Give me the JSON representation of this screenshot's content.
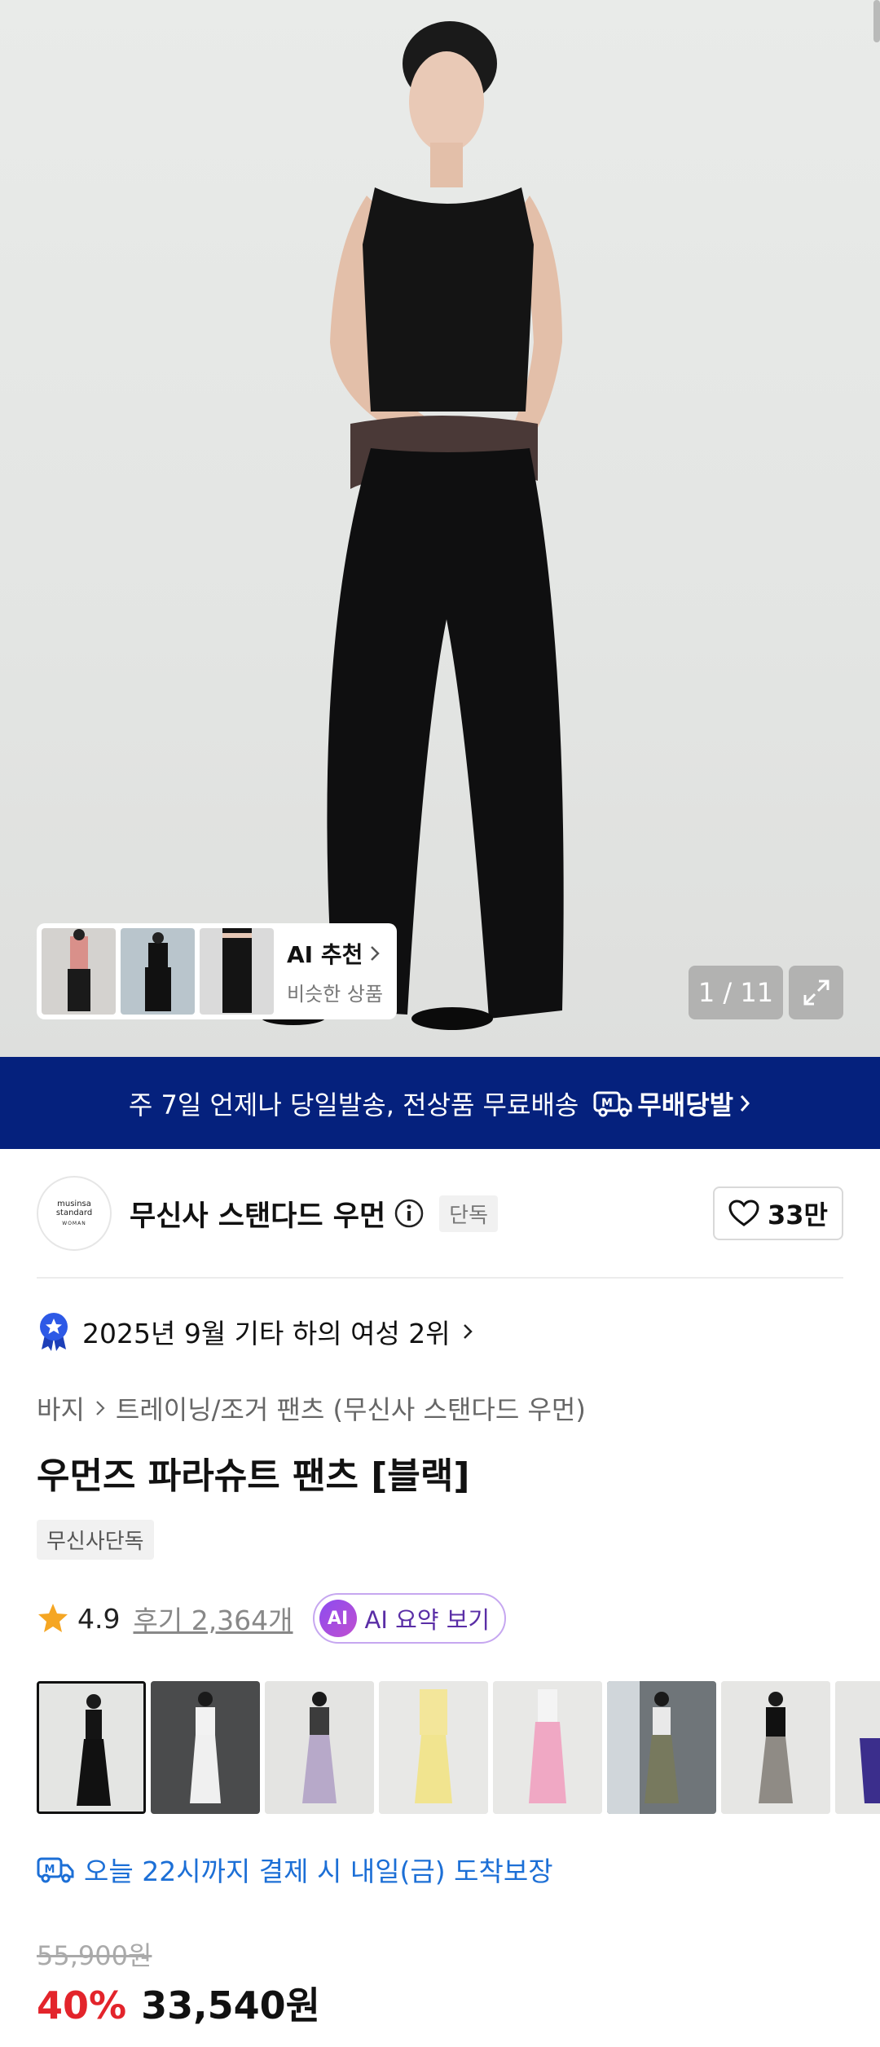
{
  "hero": {
    "counter": "1 / 11",
    "ai_card": {
      "title": "AI 추천",
      "subtitle": "비슷한 상품"
    }
  },
  "banner": {
    "text": "주 7일 언제나 당일발송, 전상품 무료배송",
    "brand": "무배당발"
  },
  "brand": {
    "logo_line1": "musinsa",
    "logo_line2": "standard",
    "logo_line3": "WOMAN",
    "name": "무신사 스탠다드 우먼",
    "badge": "단독",
    "likes": "33만"
  },
  "rank": {
    "text": "2025년 9월 기타 하의 여성 2위"
  },
  "breadcrumb": {
    "level1": "바지",
    "level2": "트레이닝/조거 팬츠 (무신사 스탠다드 우먼)"
  },
  "product": {
    "title": "우먼즈 파라슈트 팬츠 [블랙]",
    "tag": "무신사단독",
    "rating": "4.9",
    "reviews": "후기 2,364개",
    "ai_summary": {
      "badge": "AI",
      "label": "AI 요약 보기"
    },
    "delivery": "오늘 22시까지 결제 시 내일(금) 도착보장",
    "original_price": "55,900원",
    "discount": "40%",
    "price": "33,540원"
  },
  "colors": {
    "banner_bg": "#05217d",
    "discount": "#e3242b",
    "delivery": "#1c6fd6",
    "star": "#f5a623"
  }
}
